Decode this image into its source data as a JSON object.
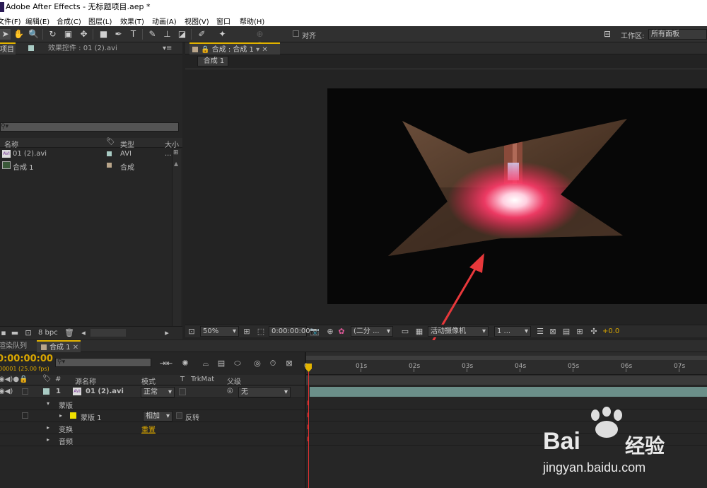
{
  "app": {
    "title": "Adobe After Effects - 无标题项目.aep *"
  },
  "menu": [
    "文件(F)",
    "编辑(E)",
    "合成(C)",
    "图层(L)",
    "效果(T)",
    "动画(A)",
    "视图(V)",
    "窗口",
    "帮助(H)"
  ],
  "toolbar": {
    "align_label": "对齐",
    "workspace_label": "工作区:",
    "workspace_value": "所有面板"
  },
  "project_panel": {
    "tabs": [
      "项目",
      "效果控件 : 01 (2).avi"
    ],
    "columns": {
      "name": "名称",
      "type": "类型",
      "size": "大小"
    },
    "items": [
      {
        "name": "01 (2).avi",
        "type": "AVI",
        "size": "...",
        "color": "#a9cbc4"
      },
      {
        "name": "合成 1",
        "type": "合成",
        "size": "",
        "color": "#b9a58a"
      }
    ],
    "bpc": "8 bpc"
  },
  "composition_panel": {
    "tab": "合成 : 合成 1",
    "breadcrumb": "合成 1",
    "zoom": "50%",
    "timecode": "0:00:00:00",
    "resolution": "(二分 ...",
    "camera": "活动摄像机",
    "views": "1 ...",
    "exposure": "+0.0"
  },
  "timeline_panel": {
    "tabs": [
      "渲染队列",
      "合成 1"
    ],
    "timecode": "0:00:00:00",
    "fps": "00001 (25.00 fps)",
    "columns": {
      "num": "#",
      "source": "源名称",
      "mode": "模式",
      "t": "T",
      "trkmat": "TrkMat",
      "parent": "父级"
    },
    "layer": {
      "num": "1",
      "name": "01 (2).avi",
      "mode": "正常",
      "parent": "无"
    },
    "rows": {
      "mask_group": "蒙版",
      "mask": "蒙版 1",
      "mask_mode": "相加",
      "invert": "反转",
      "transform": "变换",
      "reset": "重置",
      "audio": "音频"
    },
    "ruler": [
      "0s",
      "01s",
      "02s",
      "03s",
      "04s",
      "05s",
      "06s",
      "07s"
    ]
  },
  "watermark": {
    "brand": "Bai",
    "brand2": "经验",
    "url": "jingyan.baidu.com"
  },
  "colors": {
    "accent": "#e3b400",
    "arrow": "#e8383b",
    "track": "#6b8f89"
  }
}
